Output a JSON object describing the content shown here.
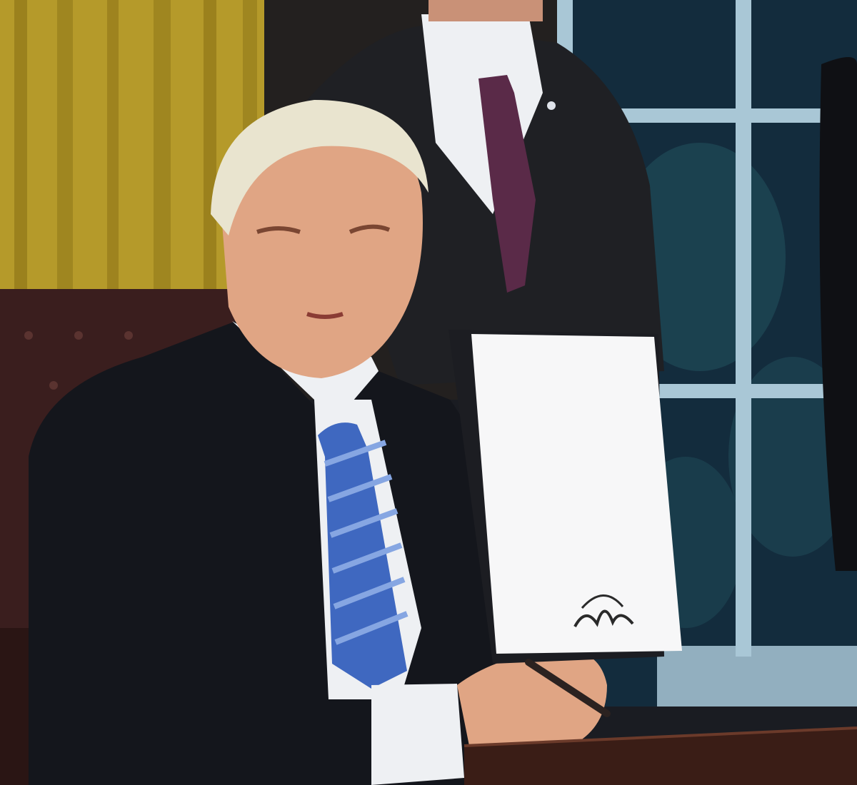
{
  "scene": {
    "description_tag": "photo",
    "colors": {
      "curtain": "#b59a2a",
      "curtain_shadow": "#8a7116",
      "window_frame": "#a9c7d6",
      "window_glass": "#132c3d",
      "foliage": "#1f4a57",
      "chair": "#3a1e1e",
      "suit": "#14161c",
      "shirt": "#eef0f3",
      "tie": "#3f68c0",
      "tie_stripe": "#86a6e2",
      "skin": "#e0a584",
      "hair": "#e9e4cf",
      "back_tie": "#5a2a48",
      "folder": "#1c1d22",
      "paper": "#f7f7f8",
      "desk": "#3a1d16",
      "signature": "#2a2a2a"
    }
  }
}
